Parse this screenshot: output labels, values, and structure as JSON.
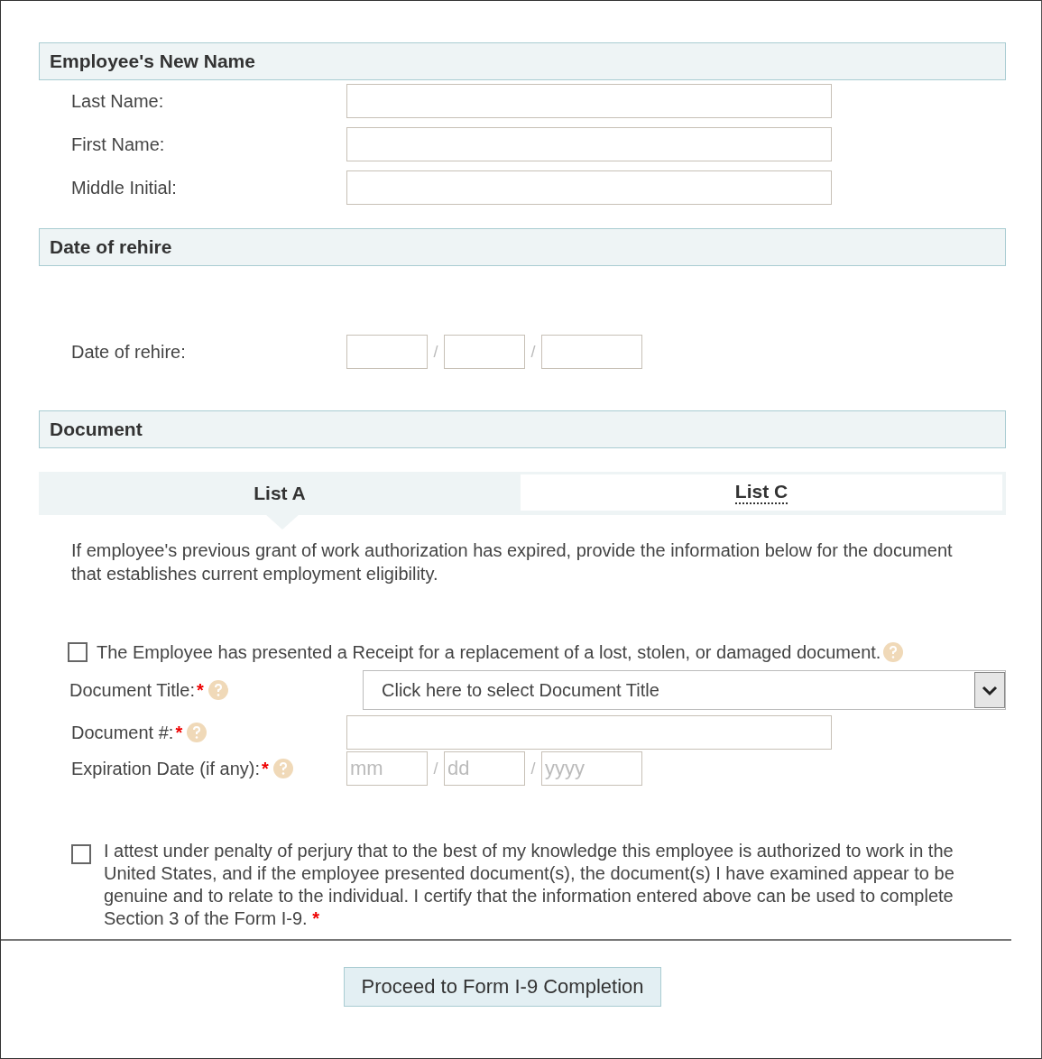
{
  "sections": [
    {
      "kind": "fields",
      "title": "Employee's New Name",
      "fields": [
        {
          "kind": "text",
          "label": "Last Name:"
        },
        {
          "kind": "text",
          "label": "First Name:"
        },
        {
          "kind": "text",
          "label": "Middle Initial:"
        }
      ]
    },
    {
      "kind": "fields",
      "title": "Date of rehire",
      "fields": [
        {
          "kind": "date",
          "label": "Date of rehire:",
          "separator": "/",
          "parts": [
            {
              "kind": "month"
            },
            {
              "kind": "day"
            },
            {
              "kind": "year"
            }
          ]
        }
      ]
    },
    {
      "kind": "document",
      "title": "Document",
      "tabs": [
        {
          "label": "List A",
          "selected": true
        },
        {
          "label": "List C",
          "selected": false
        }
      ],
      "intro": "If employee's previous grant of work authorization has expired, provide the information below for the document that establishes current employment eligibility.",
      "receipt": {
        "label": "The Employee has presented a Receipt for a replacement of a lost, stolen, or damaged document.",
        "checked": false
      },
      "fields": [
        {
          "kind": "select",
          "label": "Document Title:",
          "marker": "*",
          "placeholder": "Click here to select Document Title"
        },
        {
          "kind": "text",
          "label": "Document #:",
          "marker": "*"
        },
        {
          "kind": "date",
          "label": "Expiration Date (if any):",
          "marker": "*",
          "separator": "/",
          "parts": [
            {
              "kind": "month",
              "placeholder": "mm"
            },
            {
              "kind": "day",
              "placeholder": "dd"
            },
            {
              "kind": "year",
              "placeholder": "yyyy"
            }
          ]
        }
      ]
    }
  ],
  "attest": {
    "text": "I attest under penalty of perjury that to the best of my knowledge this employee is authorized to work in the United States, and if the employee presented document(s), the document(s) I have examined appear to be genuine and to relate to the individual. I certify that the information entered above can be used to complete Section 3 of the Form I-9.",
    "marker": "*",
    "checked": false
  },
  "button": "Proceed to Form I-9 Completion"
}
